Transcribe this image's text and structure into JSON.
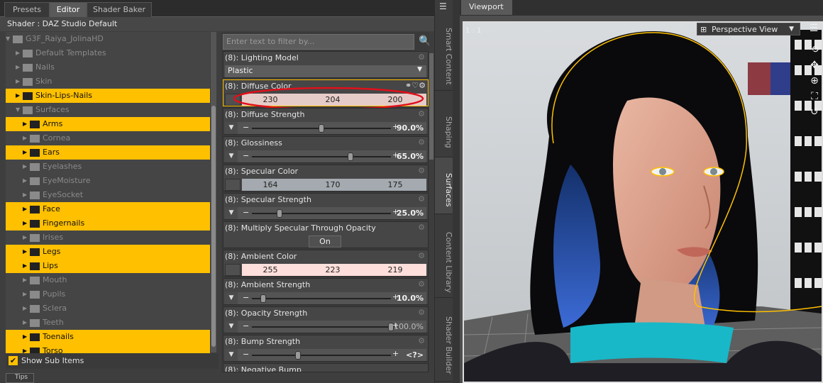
{
  "left_tabs": [
    "Presets",
    "Editor",
    "Shader Baker"
  ],
  "shader_line": "Shader : DAZ Studio Default",
  "tree": [
    {
      "label": "G3F_Raiya_JolinaHD",
      "state": "dim",
      "level": 0,
      "expanded": true
    },
    {
      "label": "Default Templates",
      "state": "dim",
      "level": 1,
      "expanded": false
    },
    {
      "label": "Nails",
      "state": "dim",
      "level": 1,
      "expanded": false
    },
    {
      "label": "Skin",
      "state": "dim",
      "level": 1,
      "expanded": false
    },
    {
      "label": "Skin-Lips-Nails",
      "state": "sel",
      "level": 1,
      "expanded": false
    },
    {
      "label": "Surfaces",
      "state": "dim",
      "level": 1,
      "expanded": true
    },
    {
      "label": "Arms",
      "state": "sel",
      "level": 2
    },
    {
      "label": "Cornea",
      "state": "dim",
      "level": 2
    },
    {
      "label": "Ears",
      "state": "sel",
      "level": 2
    },
    {
      "label": "Eyelashes",
      "state": "dim",
      "level": 2
    },
    {
      "label": "EyeMoisture",
      "state": "dim",
      "level": 2
    },
    {
      "label": "EyeSocket",
      "state": "dim",
      "level": 2
    },
    {
      "label": "Face",
      "state": "sel",
      "level": 2
    },
    {
      "label": "Fingernails",
      "state": "sel",
      "level": 2
    },
    {
      "label": "Irises",
      "state": "dim",
      "level": 2
    },
    {
      "label": "Legs",
      "state": "sel",
      "level": 2
    },
    {
      "label": "Lips",
      "state": "sel",
      "level": 2
    },
    {
      "label": "Mouth",
      "state": "dim",
      "level": 2
    },
    {
      "label": "Pupils",
      "state": "dim",
      "level": 2
    },
    {
      "label": "Sclera",
      "state": "dim",
      "level": 2
    },
    {
      "label": "Teeth",
      "state": "dim",
      "level": 2
    },
    {
      "label": "Toenails",
      "state": "sel",
      "level": 2
    },
    {
      "label": "Torso",
      "state": "sel",
      "level": 2
    }
  ],
  "show_sub_items": "Show Sub Items",
  "bottom_tab": "Tips",
  "filter_placeholder": "Enter text to filter by...",
  "props": {
    "lighting_model": {
      "title": "(8): Lighting Model",
      "value": "Plastic"
    },
    "diffuse_color": {
      "title": "(8): Diffuse Color",
      "r": "230",
      "g": "204",
      "b": "200",
      "color": "#e6ccc8"
    },
    "diffuse_strength": {
      "title": "(8): Diffuse Strength",
      "value": "90.0%",
      "level": 0.5
    },
    "glossiness": {
      "title": "(8): Glossiness",
      "value": "65.0%",
      "level": 0.71
    },
    "specular_color": {
      "title": "(8): Specular Color",
      "r": "164",
      "g": "170",
      "b": "175",
      "color": "#a4aaaf"
    },
    "specular_strength": {
      "title": "(8): Specular Strength",
      "value": "25.0%",
      "level": 0.2
    },
    "multiply_specular": {
      "title": "(8): Multiply Specular Through Opacity",
      "value": "On"
    },
    "ambient_color": {
      "title": "(8): Ambient Color",
      "r": "255",
      "g": "223",
      "b": "219",
      "color": "#ffdfdb"
    },
    "ambient_strength": {
      "title": "(8): Ambient Strength",
      "value": "10.0%",
      "level": 0.08
    },
    "opacity_strength": {
      "title": "(8): Opacity Strength",
      "value": "100.0%",
      "level": 1.0
    },
    "bump_strength": {
      "title": "(8): Bump Strength",
      "value": "<?>",
      "level": 0.33
    },
    "negative_bump": {
      "title": "(8): Negative Bump"
    }
  },
  "side_tabs": [
    "Smart Content",
    "Shaping",
    "Surfaces",
    "Content Library",
    "Shader Builder"
  ],
  "viewport": {
    "tab": "Viewport",
    "ratio": "1 : 1",
    "view": "Perspective View"
  }
}
